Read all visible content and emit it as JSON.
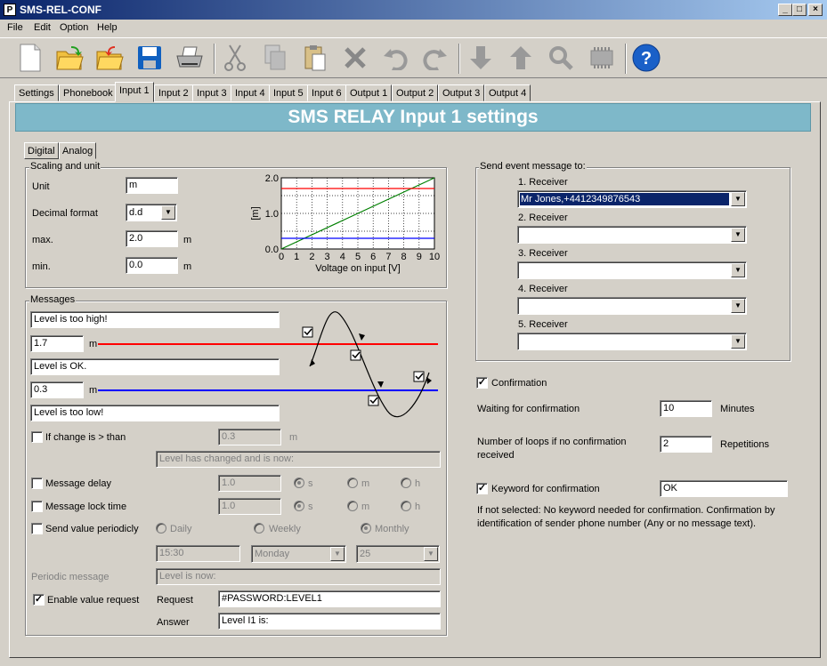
{
  "window": {
    "title": "SMS-REL-CONF",
    "app_icon": "P"
  },
  "menu": [
    "File",
    "Edit",
    "Option",
    "Help"
  ],
  "toolbar_icons": [
    "new-file-icon",
    "open-folder-icon",
    "folder-undo-icon",
    "folder-icon",
    "save-disk-icon",
    "printer-icon",
    "cut-scissors-icon",
    "copy-icon",
    "paste-icon",
    "delete-x-icon",
    "undo-icon",
    "redo-icon",
    "download-arrow-icon",
    "upload-arrow-icon",
    "search-magnifier-icon",
    "device-icon",
    "help-icon"
  ],
  "tabs": [
    "Settings",
    "Phonebook",
    "Input 1",
    "Input 2",
    "Input 3",
    "Input 4",
    "Input 5",
    "Input 6",
    "Output 1",
    "Output 2",
    "Output 3",
    "Output 4"
  ],
  "active_tab": "Input 1",
  "banner": "SMS RELAY Input 1 settings",
  "subtabs": [
    "Digital",
    "Analog"
  ],
  "scaling": {
    "group_label": "Scaling and unit",
    "unit_label": "Unit",
    "unit_value": "m",
    "decimal_label": "Decimal format",
    "decimal_value": "d.d",
    "max_label": "max.",
    "max_value": "2.0",
    "min_label": "min.",
    "min_value": "0.0",
    "unit_suffix": "m"
  },
  "chart_data": {
    "type": "line",
    "xlabel": "Voltage on input [V]",
    "ylabel": "[m]",
    "xlim": [
      0,
      10
    ],
    "ylim": [
      0,
      2
    ],
    "x_ticks": [
      "0",
      "1",
      "2",
      "3",
      "4",
      "5",
      "6",
      "7",
      "8",
      "9",
      "10"
    ],
    "y_ticks": [
      "0.0",
      "1.0",
      "2.0"
    ],
    "grid": true,
    "series": [
      {
        "color": "#008000",
        "x": [
          0,
          10
        ],
        "y": [
          0,
          2
        ]
      },
      {
        "color": "#ff0000",
        "x": [
          0,
          10
        ],
        "y": [
          1.7,
          1.7
        ]
      },
      {
        "color": "#0000ff",
        "x": [
          0,
          10
        ],
        "y": [
          0.3,
          0.3
        ]
      }
    ]
  },
  "messages": {
    "group_label": "Messages",
    "high_text": "Level is too high!",
    "high_value": "1.7",
    "ok_text": "Level is OK.",
    "low_value": "0.3",
    "low_text": "Level is too low!",
    "unit": "m",
    "change_label": "If change is > than",
    "change_value": "0.3",
    "change_text": "Level has changed and is now:",
    "delay_label": "Message delay",
    "delay_value": "1.0",
    "lock_label": "Message lock time",
    "lock_value": "1.0",
    "time_units": [
      "s",
      "m",
      "h"
    ],
    "periodic_label": "Send value periodicly",
    "period_options": [
      "Daily",
      "Weekly",
      "Monthly"
    ],
    "period_time": "15:30",
    "period_day": "Monday",
    "period_date": "25",
    "periodic_msg_label": "Periodic message",
    "periodic_msg_value": "Level is now:",
    "enable_request_label": "Enable value request",
    "request_label": "Request",
    "request_value": "#PASSWORD:LEVEL1",
    "answer_label": "Answer",
    "answer_value": "Level I1 is:"
  },
  "receivers": {
    "group_label": "Send event message to:",
    "items": [
      {
        "label": "1. Receiver",
        "value": "Mr Jones,+4412349876543"
      },
      {
        "label": "2. Receiver",
        "value": ""
      },
      {
        "label": "3. Receiver",
        "value": ""
      },
      {
        "label": "4. Receiver",
        "value": ""
      },
      {
        "label": "5. Receiver",
        "value": ""
      }
    ]
  },
  "confirmation": {
    "label": "Confirmation",
    "waiting_label": "Waiting for confirmation",
    "waiting_value": "10",
    "waiting_unit": "Minutes",
    "loops_label_1": "Number of loops if no confirmation",
    "loops_label_2": "received",
    "loops_value": "2",
    "loops_unit": "Repetitions",
    "keyword_label": "Keyword for confirmation",
    "keyword_value": "OK",
    "note_1": "If not selected: No keyword needed for confirmation.  Confirmation by",
    "note_2": "identification of sender phone number (Any or no message text)."
  }
}
